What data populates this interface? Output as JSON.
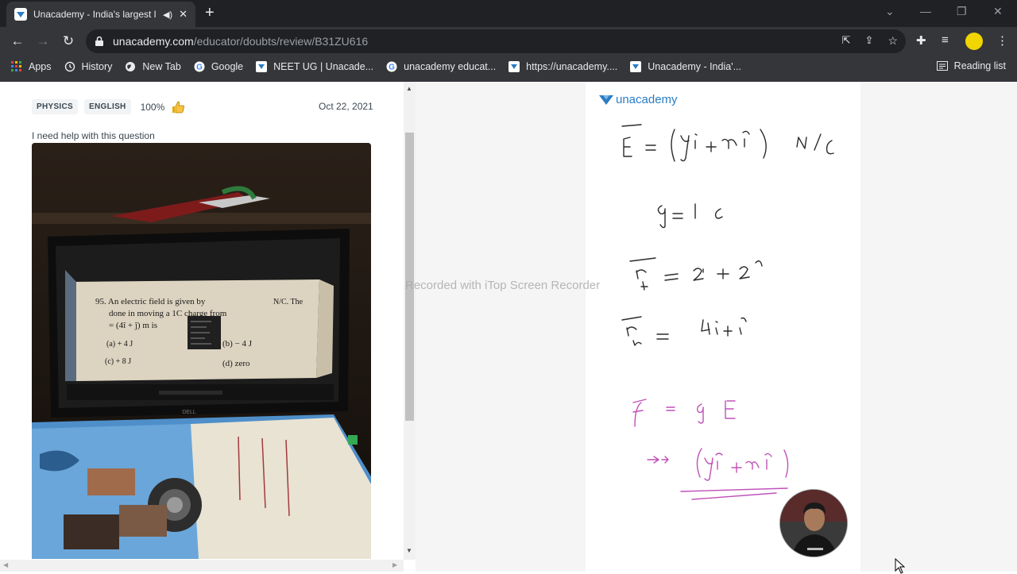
{
  "browser": {
    "tab_title": "Unacademy - India's largest l",
    "url_host": "unacademy.com",
    "url_path": "/educator/doubts/review/B31ZU616",
    "bookmarks": [
      {
        "label": "Apps",
        "icon": "apps-grid-icon"
      },
      {
        "label": "History",
        "icon": "history-icon"
      },
      {
        "label": "New Tab",
        "icon": "globe-icon"
      },
      {
        "label": "Google",
        "icon": "google-icon"
      },
      {
        "label": "NEET UG | Unacade...",
        "icon": "unacademy-icon"
      },
      {
        "label": "unacademy educat...",
        "icon": "google-icon"
      },
      {
        "label": "https://unacademy....",
        "icon": "unacademy-icon"
      },
      {
        "label": "Unacademy - India'...",
        "icon": "unacademy-icon"
      }
    ],
    "reading_list": "Reading list"
  },
  "doubt": {
    "subject": "PHYSICS",
    "language": "ENGLISH",
    "rating": "100%",
    "date": "Oct 22, 2021",
    "question": "I need help with this question"
  },
  "photo_text": {
    "q_line1": "95.  An electric field is given by",
    "q_line1b": "N/C. The",
    "q_line2": "done in moving a 1C charge from",
    "q_line3": "= (4î + ĵ) m is",
    "opt_a": "(a)  + 4 J",
    "opt_b": "(b)  − 4 J",
    "opt_c": "(c)  + 8 J",
    "opt_d": "(d)  zero",
    "brand": "DELL"
  },
  "board": {
    "brand": "unacademy"
  },
  "watermark": "Recorded with iTop Screen Recorder",
  "colors": {
    "accent": "#2a7dc4",
    "ink_dark": "#2b2b2b",
    "ink_pink": "#c050b8"
  }
}
